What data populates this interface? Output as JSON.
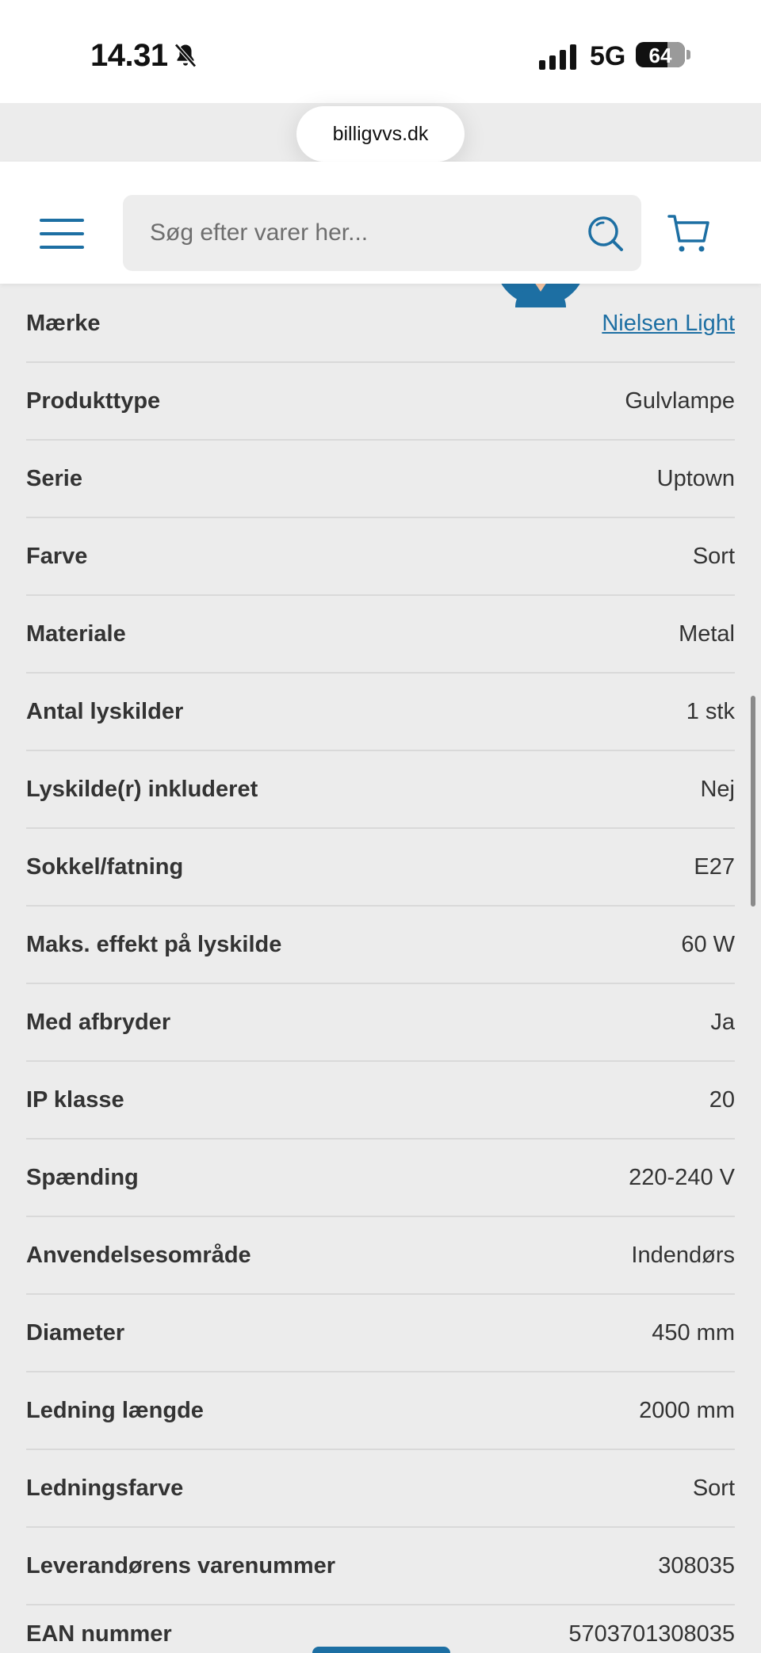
{
  "status": {
    "time": "14.31",
    "network": "5G",
    "battery": "64",
    "battery_level": 0.64
  },
  "browser": {
    "url": "billigvvs.dk"
  },
  "header": {
    "search_placeholder": "Søg efter varer her..."
  },
  "specs": [
    {
      "key": "Mærke",
      "value": "Nielsen Light",
      "link": true
    },
    {
      "key": "Produkttype",
      "value": "Gulvlampe"
    },
    {
      "key": "Serie",
      "value": "Uptown"
    },
    {
      "key": "Farve",
      "value": "Sort"
    },
    {
      "key": "Materiale",
      "value": "Metal"
    },
    {
      "key": "Antal lyskilder",
      "value": "1 stk"
    },
    {
      "key": "Lyskilde(r) inkluderet",
      "value": "Nej"
    },
    {
      "key": "Sokkel/fatning",
      "value": "E27"
    },
    {
      "key": "Maks. effekt på lyskilde",
      "value": "60 W"
    },
    {
      "key": "Med afbryder",
      "value": "Ja"
    },
    {
      "key": "IP klasse",
      "value": "20"
    },
    {
      "key": "Spænding",
      "value": "220-240 V"
    },
    {
      "key": "Anvendelsesområde",
      "value": "Indendørs"
    },
    {
      "key": "Diameter",
      "value": "450 mm"
    },
    {
      "key": "Ledning længde",
      "value": "2000 mm"
    },
    {
      "key": "Ledningsfarve",
      "value": "Sort"
    },
    {
      "key": "Leverandørens varenummer",
      "value": "308035"
    },
    {
      "key": "EAN nummer",
      "value": "5703701308035"
    }
  ],
  "colors": {
    "accent": "#1d6fa3",
    "background": "#ececec"
  }
}
